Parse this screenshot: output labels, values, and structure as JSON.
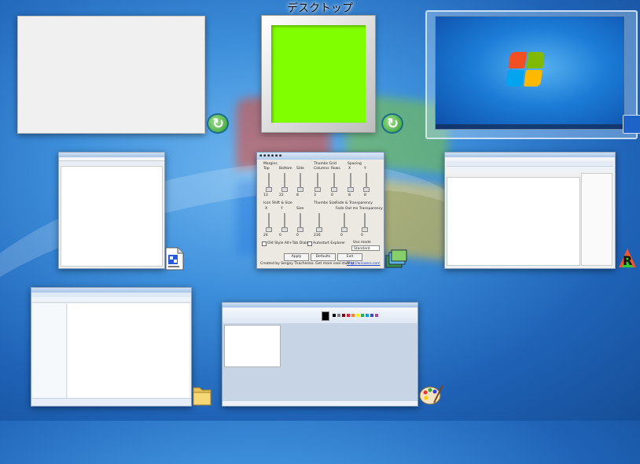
{
  "switcher": {
    "title": "デスクトップ"
  },
  "windows": [
    {
      "name": "blank-window",
      "icon": "refresh-icon"
    },
    {
      "name": "green-frame-window",
      "icon": "refresh-icon"
    },
    {
      "name": "desktop",
      "icon": "monitor-icon",
      "selected": true
    },
    {
      "name": "notepad-window",
      "icon": "document-icon"
    },
    {
      "name": "thumbnail-tweaker-window",
      "icon": "photos-icon"
    },
    {
      "name": "app-window",
      "icon": "r-logo-icon"
    },
    {
      "name": "explorer-window",
      "icon": "folder-icon"
    },
    {
      "name": "paint-window",
      "icon": "palette-icon"
    }
  ],
  "tweaker": {
    "margins_label": "Margins",
    "thumb_grid_label": "Thumbs Grid",
    "spacing_label": "Spacing",
    "top_label": "Top",
    "bottom_label": "Bottom",
    "side_label": "Side",
    "columns_label": "Columns",
    "rows_label": "Rows",
    "x_label": "X",
    "y_label": "Y",
    "top_val": "13",
    "bottom_val": "22",
    "side_val": "8",
    "columns_val": "3",
    "rows_val": "0",
    "xval": "8",
    "yval": "8",
    "icon_shift_label": "Icon Shift & Size",
    "thumb_size_label": "Thumbs Size",
    "fade_label": "Fade & Transparency",
    "fade_sub_label": "Fade Out ms  Transparency",
    "x2_label": "X",
    "y2_label": "Y",
    "size_label": "Size",
    "x2_val": "24",
    "y2_val": "0",
    "size_val": "0",
    "thumb_val": "216",
    "fade_val": "0",
    "trans_val": "0",
    "old_style_label": "Old Style Alt+Tab Dialog",
    "autostart_label": "Autostart Explorer",
    "usemode_label": "Use mode",
    "usemode_value": "Standard",
    "apply_label": "Apply",
    "defaults_label": "Defaults",
    "exit_label": "Exit",
    "credits": "Created by Sergey Tkachenko. Get more cool stuff at:",
    "credits_link": "http://winaero.com"
  },
  "colors": {
    "accent_green": "#7fff00",
    "selection": "#c9ddf2"
  }
}
